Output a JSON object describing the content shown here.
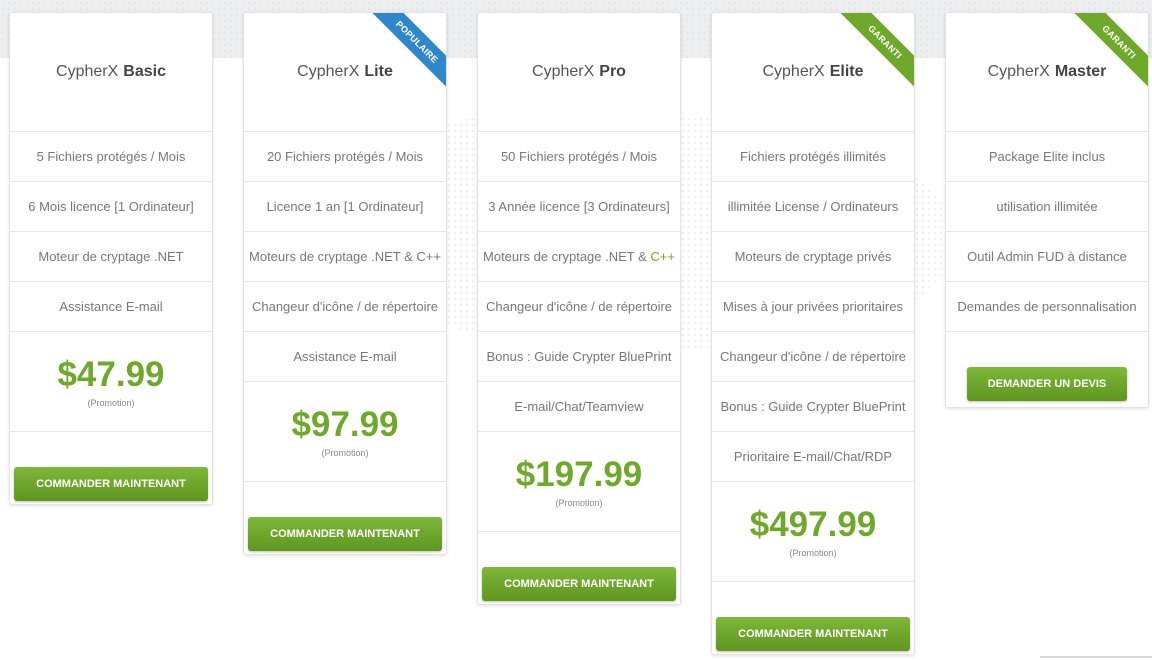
{
  "plans": [
    {
      "name_prefix": "CypherX",
      "name_bold": "Basic",
      "features": [
        "5 Fichiers protégés / Mois",
        "6 Mois licence [1 Ordinateur]",
        "Moteur de cryptage .NET",
        "Assistance E-mail"
      ],
      "price": "$47.99",
      "promo": "(Promotion)",
      "cta": "COMMANDER MAINTENANT"
    },
    {
      "name_prefix": "CypherX",
      "name_bold": "Lite",
      "ribbon": "POPULAIRE",
      "features": [
        "20 Fichiers protégés / Mois",
        "Licence 1 an [1 Ordinateur]",
        "Moteurs de cryptage .NET & C++",
        "Changeur d'icône / de répertoire",
        "Assistance E-mail"
      ],
      "price": "$97.99",
      "promo": "(Promotion)",
      "cta": "COMMANDER MAINTENANT"
    },
    {
      "name_prefix": "CypherX",
      "name_bold": "Pro",
      "features": [
        "50 Fichiers protégés / Mois",
        "3 Année licence [3 Ordinateurs]",
        "Moteurs de cryptage .NET & ",
        "Changeur d'icône / de répertoire",
        "Bonus : Guide Crypter BluePrint",
        "E-mail/Chat/Teamview"
      ],
      "feature_highlight": "C++",
      "price": "$197.99",
      "promo": "(Promotion)",
      "cta": "COMMANDER MAINTENANT"
    },
    {
      "name_prefix": "CypherX",
      "name_bold": "Elite",
      "ribbon": "GARANTI",
      "features": [
        "Fichiers protégés illimités",
        "illimitée License / Ordinateurs",
        "Moteurs de cryptage privés",
        "Mises à jour privées prioritaires",
        "Changeur d'icône / de répertoire",
        "Bonus : Guide Crypter BluePrint",
        "Prioritaire E-mail/Chat/RDP"
      ],
      "price": "$497.99",
      "promo": "(Promotion)",
      "cta": "COMMANDER MAINTENANT"
    },
    {
      "name_prefix": "CypherX",
      "name_bold": "Master",
      "ribbon": "GARANTI",
      "features": [
        "Package Elite inclus",
        "utilisation illimitée",
        "Outil Admin FUD à distance",
        "Demandes de personnalisation"
      ],
      "cta": "DEMANDER UN DEVIS"
    }
  ],
  "colors": {
    "price_green": "#6fa92b",
    "button_green": "#6fa92b",
    "ribbon_blue": "#2f86c9",
    "ribbon_green": "#6fa92b",
    "highlight_green": "#6fa92b"
  }
}
